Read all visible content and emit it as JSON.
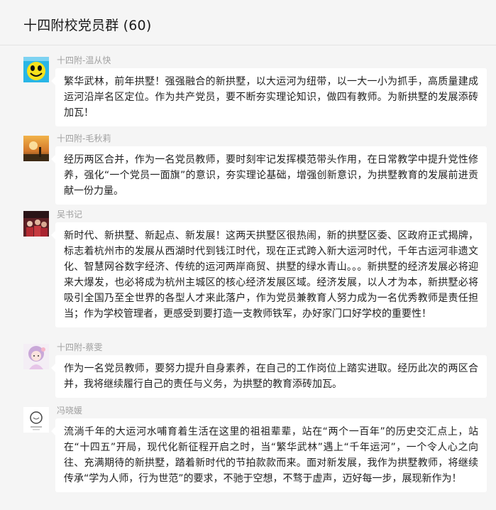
{
  "header": {
    "title": "十四附校党员群 (60)"
  },
  "messages": [
    {
      "sender": "十四附-温从快",
      "avatar": "smiley-avatar",
      "text": "繁华武林，前年拱墅！强强融合的新拱墅，以大运河为纽带，以一大一小为抓手，高质量建成运河沿岸名区定位。作为共产党员，要不断夯实理论知识，做四有教师。为新拱墅的发展添砖加瓦！"
    },
    {
      "sender": "十四附-毛秋莉",
      "avatar": "sunset-avatar",
      "text": "经历两区合并，作为一名党员教师，要时刻牢记发挥模范带头作用，在日常教学中提升党性修养，强化“一个党员一面旗”的意识，夯实理论基础，增强创新意识，为拱墅教育的发展前进贡献一份力量。"
    },
    {
      "sender": "吴书记",
      "avatar": "photo-avatar",
      "text": "新时代、新拱墅、新起点、新发展！这两天拱墅区很热闹，新的拱墅区委、区政府正式揭牌，标志着杭州市的发展从西湖时代到钱江时代，现在正式跨入新大运河时代，千年古运河非遗文化、智慧网谷数字经济、传统的运河两岸商贸、拱墅的绿水青山。。。新拱墅的经济发展必将迎来大爆发，也必将成为杭州主城区的核心经济发展区域。经济发展，以人才为本，新拱墅必将吸引全国乃至全世界的各型人才来此落户，作为党员兼教育人努力成为一名优秀教师是责任担当；作为学校管理者，更感受到要打造一支教师铁军，办好家门口好学校的重要性！"
    },
    {
      "sender": "十四附-蔡雯",
      "avatar": "cartoon-avatar",
      "text": "作为一名党员教师，要努力提升自身素养，在自己的工作岗位上踏实进取。经历此次的两区合并，我将继续履行自己的责任与义务，为拱墅的教育添砖加瓦。"
    },
    {
      "sender": "冯晓媛",
      "avatar": "sketch-avatar",
      "text": "流淌千年的大运河水哺育着生活在这里的祖祖辈辈，站在“两个一百年”的历史交汇点上，站在“十四五”开局，现代化新征程开启之时，当“繁华武林”遇上“千年运河”，一个令人心之向往、充满期待的新拱墅，踏着新时代的节拍款款而来。面对新发展，我作为拱墅教师，将继续传承“学为人师，行为世范”的要求，不驰于空想，不骛于虚声，迈好每一步，展现新作为！"
    }
  ],
  "colors": {
    "background": "#f5f5f5",
    "bubble": "#ffffff",
    "sender": "#a0a0a0",
    "text": "#222222"
  }
}
